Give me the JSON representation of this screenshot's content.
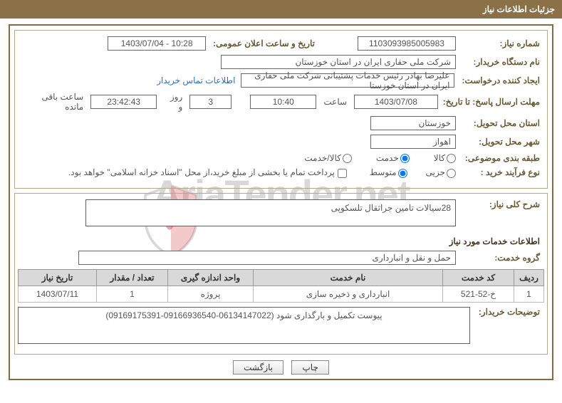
{
  "header_title": "جزئیات اطلاعات نیاز",
  "labels": {
    "need_number": "شماره نیاز:",
    "announce_datetime": "تاریخ و ساعت اعلان عمومی:",
    "buyer_org": "نام دستگاه خریدار:",
    "request_creator": "ایجاد کننده درخواست:",
    "buyer_contact": "اطلاعات تماس خریدار",
    "deadline": "مهلت ارسال پاسخ: تا تاریخ:",
    "hour": "ساعت",
    "day_and": "روز و",
    "remaining": "ساعت باقی مانده",
    "delivery_province": "استان محل تحویل:",
    "delivery_city": "شهر محل تحویل:",
    "category": "طبقه بندی موضوعی:",
    "radio_kala": "کالا",
    "radio_khadamat": "خدمت",
    "radio_kala_khadmat": "کالا/خدمت",
    "purchase_type": "نوع فرآیند خرید :",
    "radio_jozee": "جزیی",
    "radio_motavaset": "متوسط",
    "payment_note": "پرداخت تمام یا بخشی از مبلغ خرید،از محل \"اسناد خزانه اسلامی\" خواهد بود.",
    "need_overview": "شرح کلی نیاز:",
    "services_info": "اطلاعات خدمات مورد نیاز",
    "service_group": "گروه خدمت:",
    "buyer_notes": "توضیحات خریدار:"
  },
  "values": {
    "need_number": "1103093985005983",
    "announce_datetime": "1403/07/04 - 10:28",
    "buyer_org": "شرکت ملی حفاری ایران در استان خوزستان",
    "request_creator": "علیرضا بهادر رئیس خدمات پشتیبانی شرکت ملی حفاری ایران در استان خوزستا",
    "deadline_date": "1403/07/08",
    "deadline_time": "10:40",
    "days": "3",
    "countdown": "23:42:43",
    "province": "خوزستان",
    "city": "اهواز",
    "need_overview": "28سیالات تامین جراثقال تلسکوپی",
    "service_group": "حمل و نقل و انبارداری",
    "buyer_notes": "پیوست تکمیل و بارگذاری شود (06134147022-09166936540-09169175391)"
  },
  "table": {
    "headers": {
      "row": "ردیف",
      "code": "کد خدمت",
      "name": "نام خدمت",
      "unit": "واحد اندازه گیری",
      "qty": "تعداد / مقدار",
      "need_date": "تاریخ نیاز"
    },
    "rows": [
      {
        "row": "1",
        "code": "خ-52-521",
        "name": "انبارداری و ذخیره سازی",
        "unit": "پروژه",
        "qty": "1",
        "need_date": "1403/07/11"
      }
    ]
  },
  "buttons": {
    "print": "چاپ",
    "back": "بازگشت"
  },
  "watermark_text": "AriaTender.net"
}
